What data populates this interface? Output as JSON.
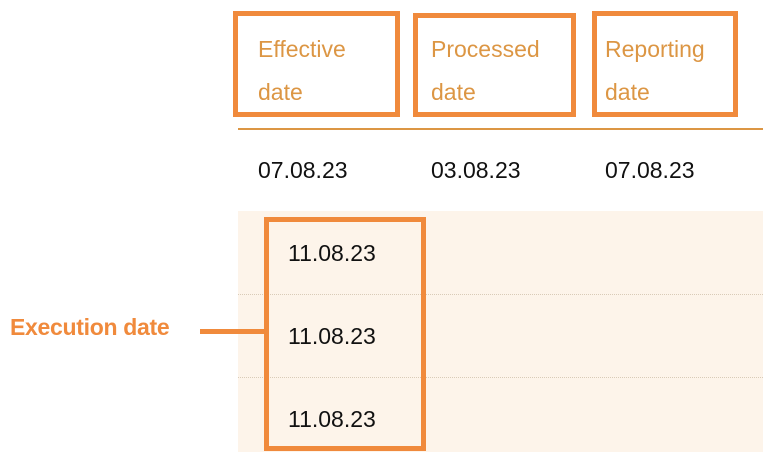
{
  "table": {
    "headers": [
      {
        "line1": "Effective",
        "line2": "date"
      },
      {
        "line1": "Processed",
        "line2": "date"
      },
      {
        "line1": "Reporting",
        "line2": "date"
      }
    ],
    "first_row": [
      "07.08.23",
      "03.08.23",
      "07.08.23"
    ],
    "execution_rows": [
      "11.08.23",
      "11.08.23",
      "11.08.23"
    ]
  },
  "callout": {
    "label": "Execution date"
  },
  "colors": {
    "header_text": "#dc9644",
    "highlight": "#f08a3c",
    "shaded_background": "#fdf4ea"
  }
}
